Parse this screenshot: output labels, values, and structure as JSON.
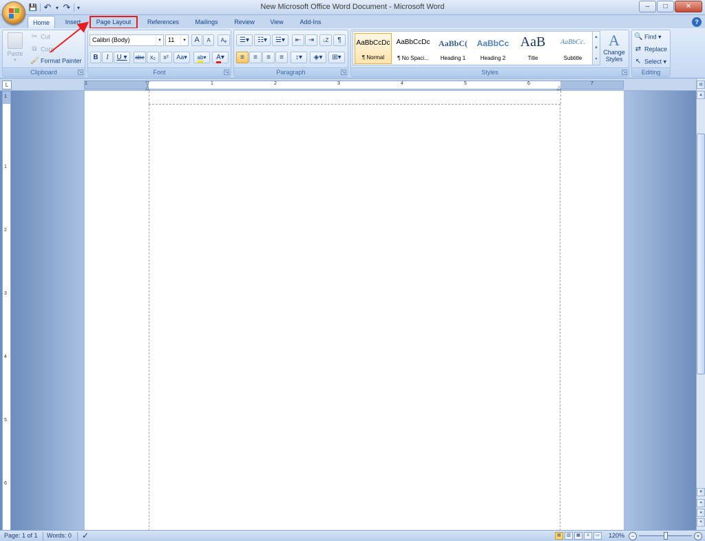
{
  "window": {
    "title": "New Microsoft Office Word Document - Microsoft Word",
    "minimize": "–",
    "maximize": "□",
    "close": "✕"
  },
  "qat": {
    "save": "💾",
    "undo": "↶",
    "undo_drop": "▾",
    "redo": "↷",
    "customize": "▾"
  },
  "tabs": [
    {
      "label": "Home"
    },
    {
      "label": "Insert"
    },
    {
      "label": "Page Layout"
    },
    {
      "label": "References"
    },
    {
      "label": "Mailings"
    },
    {
      "label": "Review"
    },
    {
      "label": "View"
    },
    {
      "label": "Add-Ins"
    }
  ],
  "help": "?",
  "clipboard": {
    "label": "Clipboard",
    "paste": "Paste",
    "cut": "Cut",
    "copy": "Copy",
    "format_painter": "Format Painter"
  },
  "font": {
    "label": "Font",
    "name": "Calibri (Body)",
    "size": "11",
    "grow": "A",
    "shrink": "A",
    "clear": "Aᵩ",
    "bold": "B",
    "italic": "I",
    "underline": "U",
    "strike": "abe",
    "subscript": "x₂",
    "superscript": "x²",
    "case": "Aa",
    "highlight": "ab",
    "font_color": "A"
  },
  "paragraph": {
    "label": "Paragraph",
    "bullets": "☰",
    "numbering": "☷",
    "multilevel": "☱",
    "decrease_indent": "⇤",
    "increase_indent": "⇥",
    "sort": "↓Z",
    "show_marks": "¶",
    "align_left": "≡",
    "center": "≡",
    "align_right": "≡",
    "justify": "≡",
    "line_spacing": "↕",
    "shading": "◈",
    "borders": "⊞"
  },
  "styles": {
    "label": "Styles",
    "items": [
      {
        "sample": "AaBbCcDc",
        "name": "¶ Normal"
      },
      {
        "sample": "AaBbCcDc",
        "name": "¶ No Spaci..."
      },
      {
        "sample": "AaBbC(",
        "name": "Heading 1"
      },
      {
        "sample": "AaBbCc",
        "name": "Heading 2"
      },
      {
        "sample": "AaB",
        "name": "Title"
      },
      {
        "sample": "AaBbCc.",
        "name": "Subtitle"
      }
    ],
    "change_styles": "Change Styles"
  },
  "editing": {
    "label": "Editing",
    "find": "Find",
    "replace": "Replace",
    "select": "Select"
  },
  "ruler": {
    "tab_selector": "L",
    "numbers": [
      "1",
      "1",
      "2",
      "3",
      "4",
      "5",
      "6",
      "7"
    ],
    "vnumbers": [
      "1",
      "1",
      "2",
      "3",
      "4",
      "5",
      "6"
    ]
  },
  "status": {
    "page": "Page: 1 of 1",
    "words": "Words: 0",
    "zoom": "120%",
    "zoom_out": "−",
    "zoom_in": "+"
  },
  "colors": {
    "ribbon": "#d0e0f5",
    "accent": "#15428b",
    "highlight_border": "#e81c1c"
  }
}
